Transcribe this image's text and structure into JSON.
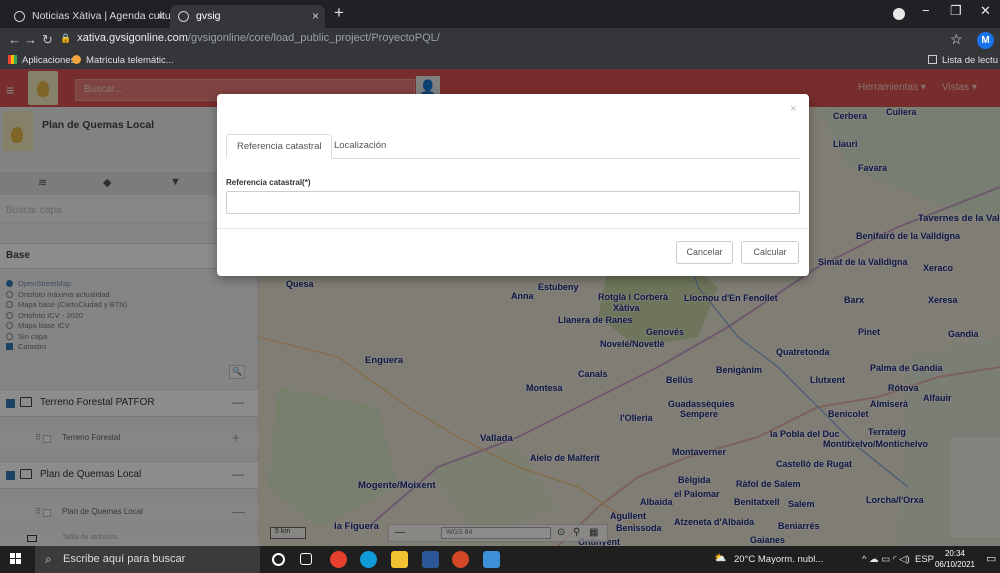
{
  "browser": {
    "tabs": [
      {
        "title": "Noticias Xàtiva | Agenda cultural",
        "close": "×"
      },
      {
        "title": "gvsig",
        "close": "×"
      }
    ],
    "new_tab": "+",
    "window_controls": {
      "minimize": "−",
      "maximize": "❐",
      "close": "✕"
    },
    "url_domain": "xativa.gvsigonline.com",
    "url_path": "/gvsigonline/core/load_public_project/ProyectoPQL/",
    "avatar_letter": "M",
    "bookmarks": [
      {
        "label": "Aplicaciones",
        "icon": "apps-grid-icon"
      },
      {
        "label": "Matrícula telemátic...",
        "icon": "bookmark-favicon"
      }
    ],
    "reading_list": "Lista de lectu"
  },
  "app": {
    "search_placeholder": "Buscar...",
    "menu_herramientas": "Herramientas ▾",
    "menu_vistas": "Vistas ▾",
    "project_title": "Plan de Quemas Local",
    "sidebar_tabs": [
      "layers-icon",
      "tag-icon",
      "filter-icon"
    ],
    "layer_search_placeholder": "Buscar capa",
    "base_header": "Base",
    "base_layers": [
      {
        "label": "OpenStreetMap",
        "selected": true
      },
      {
        "label": "Ortofoto máxima actualidad",
        "selected": false
      },
      {
        "label": "Mapa base (CartoCiudad y BTN)",
        "selected": false
      },
      {
        "label": "Ortofoto ICV - 2020",
        "selected": false
      },
      {
        "label": "Mapa base ICV",
        "selected": false
      },
      {
        "label": "Sin capa",
        "selected": false
      }
    ],
    "catastro_label": "Catastro",
    "groups": [
      {
        "label": "Terreno Forestal PATFOR",
        "button": "—",
        "layer": "Terreno Forestal",
        "layer_button": "+"
      },
      {
        "label": "Plan de Quemas Local",
        "button": "—",
        "layer": "Plan de Quemas Local",
        "layer_button": "—"
      }
    ],
    "attribute_table": "Tabla de atributos"
  },
  "map": {
    "places": [
      "Cerbera",
      "Culiera",
      "Llauri",
      "Favara",
      "Tavernes de la Vall",
      "Benifairó de la Valldigna",
      "Simat de la Valldigna",
      "Xeraco",
      "Quesa",
      "Anna",
      "Estubeny",
      "Barx",
      "Xeresa",
      "Gandia",
      "Pinet",
      "Enguera",
      "Quatretonda",
      "Palma de Gandia",
      "Llutxent",
      "Rótova",
      "Almiserà",
      "Alfauir",
      "Montesa",
      "Canals",
      "Bellús",
      "Benigànim",
      "Guadassèquies",
      "Sempere",
      "l'Olleria",
      "Benicolet",
      "Vallada",
      "Aielo de Malferit",
      "Montaverner",
      "Castelló de Rugat",
      "Bèlgida",
      "Ràfol de Salem",
      "Albaida",
      "el Palomar",
      "Benitatxell",
      "Salem",
      "Lorcha/l'Orxa",
      "Mogente/Moixent",
      "Agullent",
      "Benissoda",
      "Atzeneta d'Albaida",
      "Beniarrés",
      "Gaianes",
      "la Figuera",
      "Ontinyent",
      "Llanera de Ranes",
      "Genovés",
      "Xàtiva",
      "Novelé/Novetlè",
      "la Pobla del Duc",
      "Terrateig",
      "Montitxelvo/Montichelvo",
      "Llocnou d'En Fenollet",
      "Rotglà i Corberà"
    ],
    "crs": "WGS 84",
    "scale": "5 km"
  },
  "modal": {
    "close": "×",
    "tabs": [
      "Referencia catastral",
      "Localización"
    ],
    "field_label": "Referencia catastral(*)",
    "field_value": "",
    "cancel": "Cancelar",
    "calculate": "Calcular"
  },
  "taskbar": {
    "search_placeholder": "Escribe aquí para buscar",
    "weather": "20°C  Mayorm. nubl...",
    "lang": "ESP",
    "time": "20:34",
    "date": "06/10/2021"
  }
}
